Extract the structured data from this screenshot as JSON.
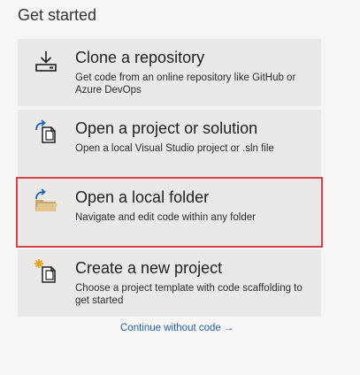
{
  "heading": "Get started",
  "cards": [
    {
      "title": "Clone a repository",
      "description": "Get code from an online repository like GitHub or Azure DevOps",
      "icon": "clone-download-icon"
    },
    {
      "title": "Open a project or solution",
      "description": "Open a local Visual Studio project or .sln file",
      "icon": "open-solution-icon"
    },
    {
      "title": "Open a local folder",
      "description": "Navigate and edit code within any folder",
      "icon": "open-folder-icon",
      "highlighted": true
    },
    {
      "title": "Create a new project",
      "description": "Choose a project template with code scaffolding to get started",
      "icon": "new-project-icon"
    }
  ],
  "continue_link": "Continue without code →",
  "colors": {
    "card_background": "#ebe9e8",
    "highlight_border": "#d9434b",
    "link": "#1f5fb4",
    "icon_blue": "#1d63b5",
    "folder_tan": "#d8b883",
    "star_orange": "#e7a21a"
  }
}
